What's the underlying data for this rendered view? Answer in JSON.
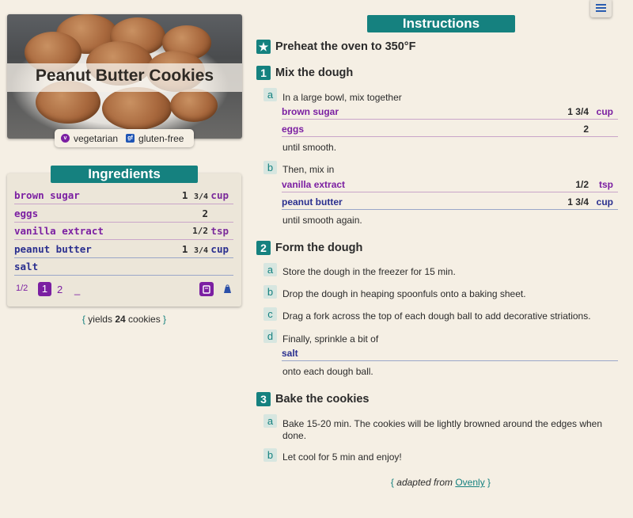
{
  "recipe": {
    "title": "Peanut Butter Cookies",
    "tags": [
      {
        "label": "vegetarian",
        "icon": "v",
        "color": "#7b1fa2"
      },
      {
        "label": "gluten-free",
        "icon": "gf",
        "color": "#1f55b5"
      }
    ]
  },
  "ingredients": {
    "heading": "Ingredients",
    "items": [
      {
        "name": "brown sugar",
        "whole": "1",
        "frac": "3/4",
        "unit": "cup",
        "color": "purple"
      },
      {
        "name": "eggs",
        "whole": "2",
        "frac": "",
        "unit": "",
        "color": "purple"
      },
      {
        "name": "vanilla extract",
        "whole": "",
        "frac": "1/2",
        "unit": "tsp",
        "color": "purple"
      },
      {
        "name": "peanut butter",
        "whole": "1",
        "frac": "3/4",
        "unit": "cup",
        "color": "blue"
      },
      {
        "name": "salt",
        "whole": "",
        "frac": "",
        "unit": "",
        "color": "blue"
      }
    ],
    "scale": {
      "half": "1/2",
      "one": "1",
      "two": "2",
      "custom": "_"
    },
    "yields": {
      "prefix": "yields",
      "count": "24",
      "suffix": "cookies"
    }
  },
  "instructions": {
    "heading": "Instructions",
    "preheat": "Preheat the oven to 350°F",
    "steps": [
      {
        "num": "1",
        "title": "Mix the dough",
        "subs": [
          {
            "letter": "a",
            "text": "In a large bowl, mix together",
            "after": "until smooth.",
            "ingredients": [
              {
                "name": "brown sugar",
                "qty": "1 3/4",
                "unit": "cup"
              },
              {
                "name": "eggs",
                "qty": "2",
                "unit": ""
              }
            ]
          },
          {
            "letter": "b",
            "text": "Then, mix in",
            "after": "until smooth again.",
            "ingredients": [
              {
                "name": "vanilla extract",
                "qty": "1/2",
                "unit": "tsp"
              },
              {
                "name": "peanut butter",
                "qty": "1 3/4",
                "unit": "cup"
              }
            ]
          }
        ]
      },
      {
        "num": "2",
        "title": "Form the dough",
        "subs": [
          {
            "letter": "a",
            "text": "Store the dough in the freezer for 15 min."
          },
          {
            "letter": "b",
            "text": "Drop the dough in heaping spoonfuls onto a baking sheet."
          },
          {
            "letter": "c",
            "text": "Drag a fork across the top of each dough ball to add decorative striations."
          },
          {
            "letter": "d",
            "text": "Finally, sprinkle a bit of",
            "after": "onto each dough ball.",
            "ingredients": [
              {
                "name": "salt",
                "qty": "",
                "unit": ""
              }
            ]
          }
        ]
      },
      {
        "num": "3",
        "title": "Bake the cookies",
        "subs": [
          {
            "letter": "a",
            "text": "Bake 15-20 min. The cookies will be lightly browned around the edges when done."
          },
          {
            "letter": "b",
            "text": "Let cool for 5 min and enjoy!"
          }
        ]
      }
    ],
    "credit": {
      "prefix": "adapted from",
      "source": "Ovenly"
    }
  },
  "icons": {
    "menu": "menu-icon",
    "preheat": "star-icon",
    "timer": "timer-icon",
    "weight": "weight-icon"
  },
  "colors": {
    "teal": "#15817f",
    "purple": "#7b1fa2",
    "blue": "#2a2f8f",
    "background": "#f5efe4"
  }
}
